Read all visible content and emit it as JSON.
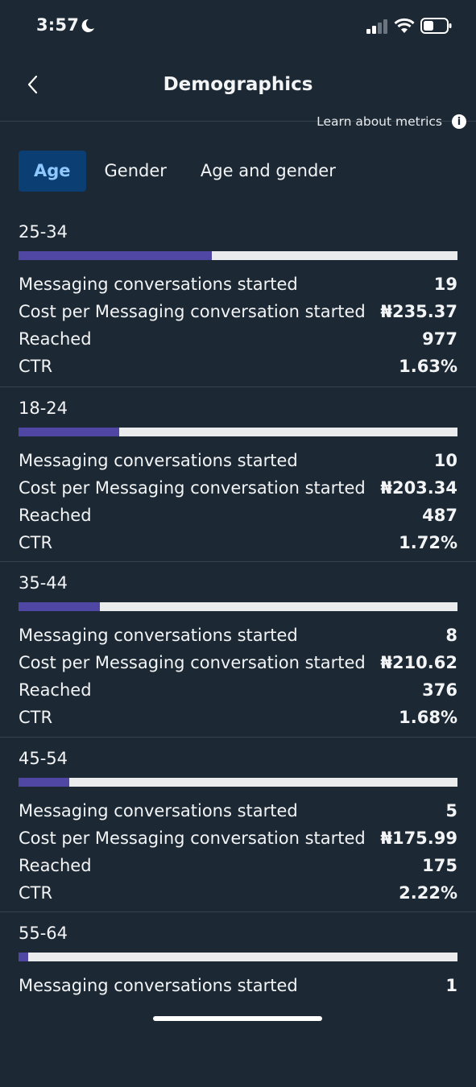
{
  "status_bar": {
    "time": "3:57"
  },
  "header": {
    "title": "Demographics",
    "learn_link": "Learn about metrics"
  },
  "tabs": [
    {
      "label": "Age",
      "active": true
    },
    {
      "label": "Gender",
      "active": false
    },
    {
      "label": "Age and gender",
      "active": false
    }
  ],
  "groups": [
    {
      "label": "25-34",
      "share": 0.44,
      "metrics": [
        {
          "label": "Messaging conversations started",
          "value": "19"
        },
        {
          "label": "Cost per Messaging conversation started",
          "value": "₦235.37"
        },
        {
          "label": "Reached",
          "value": "977"
        },
        {
          "label": "CTR",
          "value": "1.63%"
        }
      ]
    },
    {
      "label": "18-24",
      "share": 0.23,
      "metrics": [
        {
          "label": "Messaging conversations started",
          "value": "10"
        },
        {
          "label": "Cost per Messaging conversation started",
          "value": "₦203.34"
        },
        {
          "label": "Reached",
          "value": "487"
        },
        {
          "label": "CTR",
          "value": "1.72%"
        }
      ]
    },
    {
      "label": "35-44",
      "share": 0.185,
      "metrics": [
        {
          "label": "Messaging conversations started",
          "value": "8"
        },
        {
          "label": "Cost per Messaging conversation started",
          "value": "₦210.62"
        },
        {
          "label": "Reached",
          "value": "376"
        },
        {
          "label": "CTR",
          "value": "1.68%"
        }
      ]
    },
    {
      "label": "45-54",
      "share": 0.115,
      "metrics": [
        {
          "label": "Messaging conversations started",
          "value": "5"
        },
        {
          "label": "Cost per Messaging conversation started",
          "value": "₦175.99"
        },
        {
          "label": "Reached",
          "value": "175"
        },
        {
          "label": "CTR",
          "value": "2.22%"
        }
      ]
    },
    {
      "label": "55-64",
      "share": 0.022,
      "metrics": [
        {
          "label": "Messaging conversations started",
          "value": "1"
        }
      ]
    }
  ],
  "colors": {
    "background": "#1c2833",
    "bar_fill": "#5046a3",
    "bar_track": "#e9ebed",
    "active_tab_bg": "#0b3e72",
    "active_tab_text": "#8ec8ff"
  }
}
